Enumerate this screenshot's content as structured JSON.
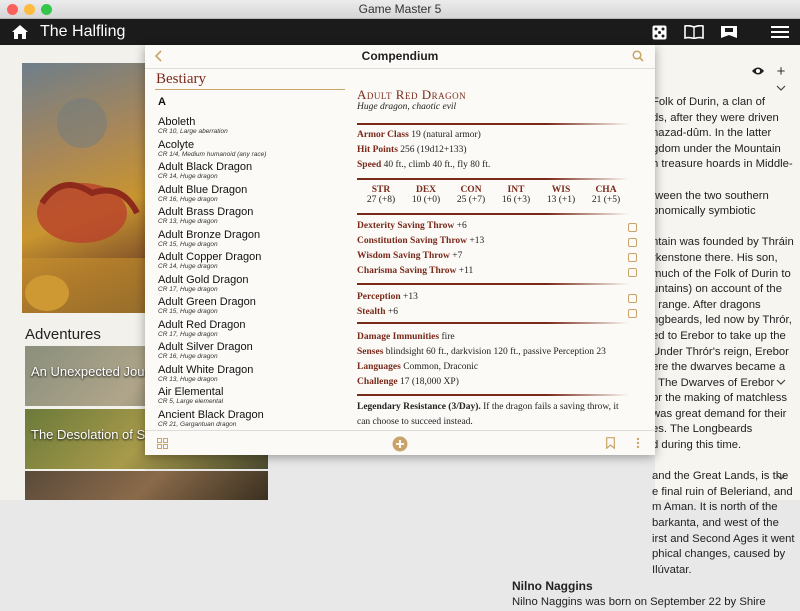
{
  "window": {
    "title": "Game Master 5"
  },
  "appbar": {
    "title": "The Halfling"
  },
  "background": {
    "adventures_label": "Adventures",
    "adventures": [
      {
        "title": "An Unexpected Journey"
      },
      {
        "title": "The Desolation of Smaug"
      },
      {
        "title": ""
      }
    ],
    "lore_lines": [
      "Folk of Durin, a clan of",
      "ds, after they were driven",
      "hazad-dûm. In the latter",
      "gdom under the Mountain",
      "h treasure hoards in Middle-",
      "",
      "tween the two southern",
      "onomically symbiotic",
      "",
      "ntain was founded by Thráin",
      "rkenstone there. His son,",
      "much of the Folk of Durin to",
      "untains) on account of the",
      "t range. After dragons",
      "ngbeards, led now by Thrór,",
      "ed to Erebor to take up the",
      "Under Thrór's reign, Erebor",
      "ere the dwarves became a",
      ". The Dwarves of Erebor",
      "or the making of matchless",
      "was great demand for their",
      "es. The Longbeards",
      "d during this time.",
      "",
      "and the Great Lands, is the",
      "e final ruin of Beleriand, and",
      "m Aman. It is north of the",
      "barkanta, and west of the",
      "irst and Second Ages it went",
      "phical changes, caused by",
      "Ilúvatar."
    ],
    "lore_heading": "Nilno Naggins",
    "lore_last": "Nilno Naggins was born on September 22 by Shire"
  },
  "modal": {
    "title": "Compendium",
    "list_title": "Bestiary",
    "section_letter": "A",
    "items": [
      {
        "name": "Aboleth",
        "sub": "CR 10, Large aberration"
      },
      {
        "name": "Acolyte",
        "sub": "CR 1/4, Medium humanoid (any race)"
      },
      {
        "name": "Adult Black Dragon",
        "sub": "CR 14, Huge dragon"
      },
      {
        "name": "Adult Blue Dragon",
        "sub": "CR 16, Huge dragon"
      },
      {
        "name": "Adult Brass Dragon",
        "sub": "CR 13, Huge dragon"
      },
      {
        "name": "Adult Bronze Dragon",
        "sub": "CR 15, Huge dragon"
      },
      {
        "name": "Adult Copper Dragon",
        "sub": "CR 14, Huge dragon"
      },
      {
        "name": "Adult Gold Dragon",
        "sub": "CR 17, Huge dragon"
      },
      {
        "name": "Adult Green Dragon",
        "sub": "CR 15, Huge dragon"
      },
      {
        "name": "Adult Red Dragon",
        "sub": "CR 17, Huge dragon"
      },
      {
        "name": "Adult Silver Dragon",
        "sub": "CR 16, Huge dragon"
      },
      {
        "name": "Adult White Dragon",
        "sub": "CR 13, Huge dragon"
      },
      {
        "name": "Air Elemental",
        "sub": "CR 5, Large elemental"
      },
      {
        "name": "Ancient Black Dragon",
        "sub": "CR 21, Gargantuan dragon"
      }
    ],
    "detail": {
      "name": "Adult Red Dragon",
      "type": "Huge dragon, chaotic evil",
      "armor_label": "Armor Class",
      "armor_value": "19 (natural armor)",
      "hp_label": "Hit Points",
      "hp_value": "256 (19d12+133)",
      "speed_label": "Speed",
      "speed_value": "40 ft., climb 40 ft., fly 80 ft.",
      "stats": [
        {
          "label": "STR",
          "value": "27 (+8)"
        },
        {
          "label": "DEX",
          "value": "10 (+0)"
        },
        {
          "label": "CON",
          "value": "25 (+7)"
        },
        {
          "label": "INT",
          "value": "16 (+3)"
        },
        {
          "label": "WIS",
          "value": "13 (+1)"
        },
        {
          "label": "CHA",
          "value": "21 (+5)"
        }
      ],
      "saves": [
        {
          "label": "Dexterity Saving Throw",
          "value": "+6"
        },
        {
          "label": "Constitution Saving Throw",
          "value": "+13"
        },
        {
          "label": "Wisdom Saving Throw",
          "value": "+7"
        },
        {
          "label": "Charisma Saving Throw",
          "value": "+11"
        }
      ],
      "skills": [
        {
          "label": "Perception",
          "value": "+13"
        },
        {
          "label": "Stealth",
          "value": "+6"
        }
      ],
      "immunities_label": "Damage Immunities",
      "immunities_value": "fire",
      "senses_label": "Senses",
      "senses_value": "blindsight 60 ft., darkvision 120 ft., passive Perception 23",
      "languages_label": "Languages",
      "languages_value": "Common, Draconic",
      "challenge_label": "Challenge",
      "challenge_value": "17 (18,000 XP)",
      "legendary_label": "Legendary Resistance (3/Day).",
      "legendary_line1": "If the dragon fails a saving throw, it",
      "legendary_line2": "can choose to succeed instead."
    }
  },
  "colors": {
    "accent": "#7a2a1a",
    "gold": "#c9a46a",
    "appbar": "#1b1b1b"
  }
}
